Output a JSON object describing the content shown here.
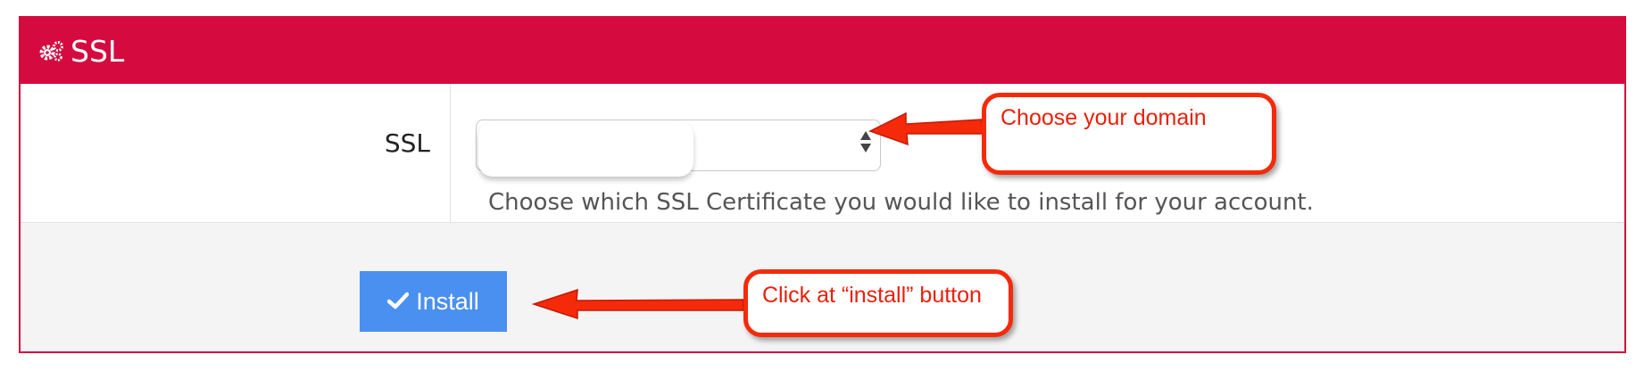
{
  "panel": {
    "title": "SSL",
    "header_icon": "cogs-icon",
    "colors": {
      "accent": "#d50a3e",
      "button": "#4a90f0",
      "callout": "#f52a0a"
    }
  },
  "form": {
    "field_label": "SSL",
    "select_value": "",
    "help_text": "Choose which SSL Certificate you would like to install for your account."
  },
  "footer": {
    "install_label": "Install",
    "install_icon": "check-icon"
  },
  "annotations": [
    {
      "text": "Choose your domain"
    },
    {
      "text": "Click at “install” button"
    }
  ]
}
